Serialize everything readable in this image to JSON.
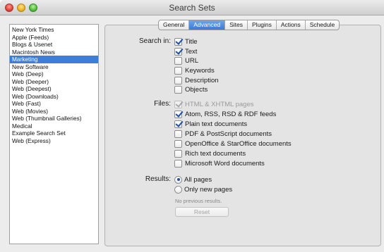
{
  "window": {
    "title": "Search Sets"
  },
  "sidebar": {
    "items": [
      {
        "label": "New York Times"
      },
      {
        "label": "Apple (Feeds)"
      },
      {
        "label": "Blogs & Usenet"
      },
      {
        "label": "Macintosh News"
      },
      {
        "label": "Marketing",
        "selected": true
      },
      {
        "label": "New Software"
      },
      {
        "label": "Web (Deep)"
      },
      {
        "label": "Web (Deeper)"
      },
      {
        "label": "Web (Deepest)"
      },
      {
        "label": "Web (Downloads)"
      },
      {
        "label": "Web (Fast)"
      },
      {
        "label": "Web (Movies)"
      },
      {
        "label": "Web (Thumbnail Galleries)"
      },
      {
        "label": "Medical"
      },
      {
        "label": "Example Search Set"
      },
      {
        "label": "Web (Express)"
      }
    ]
  },
  "tabs": [
    {
      "label": "General"
    },
    {
      "label": "Advanced",
      "active": true
    },
    {
      "label": "Sites"
    },
    {
      "label": "Plugins"
    },
    {
      "label": "Actions"
    },
    {
      "label": "Schedule"
    }
  ],
  "search_in": {
    "label": "Search in:",
    "options": [
      {
        "label": "Title",
        "checked": true
      },
      {
        "label": "Text",
        "checked": true
      },
      {
        "label": "URL",
        "checked": false
      },
      {
        "label": "Keywords",
        "checked": false
      },
      {
        "label": "Description",
        "checked": false
      },
      {
        "label": "Objects",
        "checked": false
      }
    ]
  },
  "files": {
    "label": "Files:",
    "options": [
      {
        "label": "HTML & XHTML pages",
        "checked": true,
        "disabled": true
      },
      {
        "label": "Atom, RSS, RSD & RDF feeds",
        "checked": true
      },
      {
        "label": "Plain text documents",
        "checked": true
      },
      {
        "label": "PDF & PostScript documents",
        "checked": false
      },
      {
        "label": "OpenOffice & StarOffice documents",
        "checked": false
      },
      {
        "label": "Rich text documents",
        "checked": false
      },
      {
        "label": "Microsoft Word documents",
        "checked": false
      }
    ]
  },
  "results": {
    "label": "Results:",
    "options": [
      {
        "label": "All pages",
        "selected": true
      },
      {
        "label": "Only new pages",
        "selected": false
      }
    ],
    "note": "No previous results.",
    "reset_label": "Reset"
  }
}
